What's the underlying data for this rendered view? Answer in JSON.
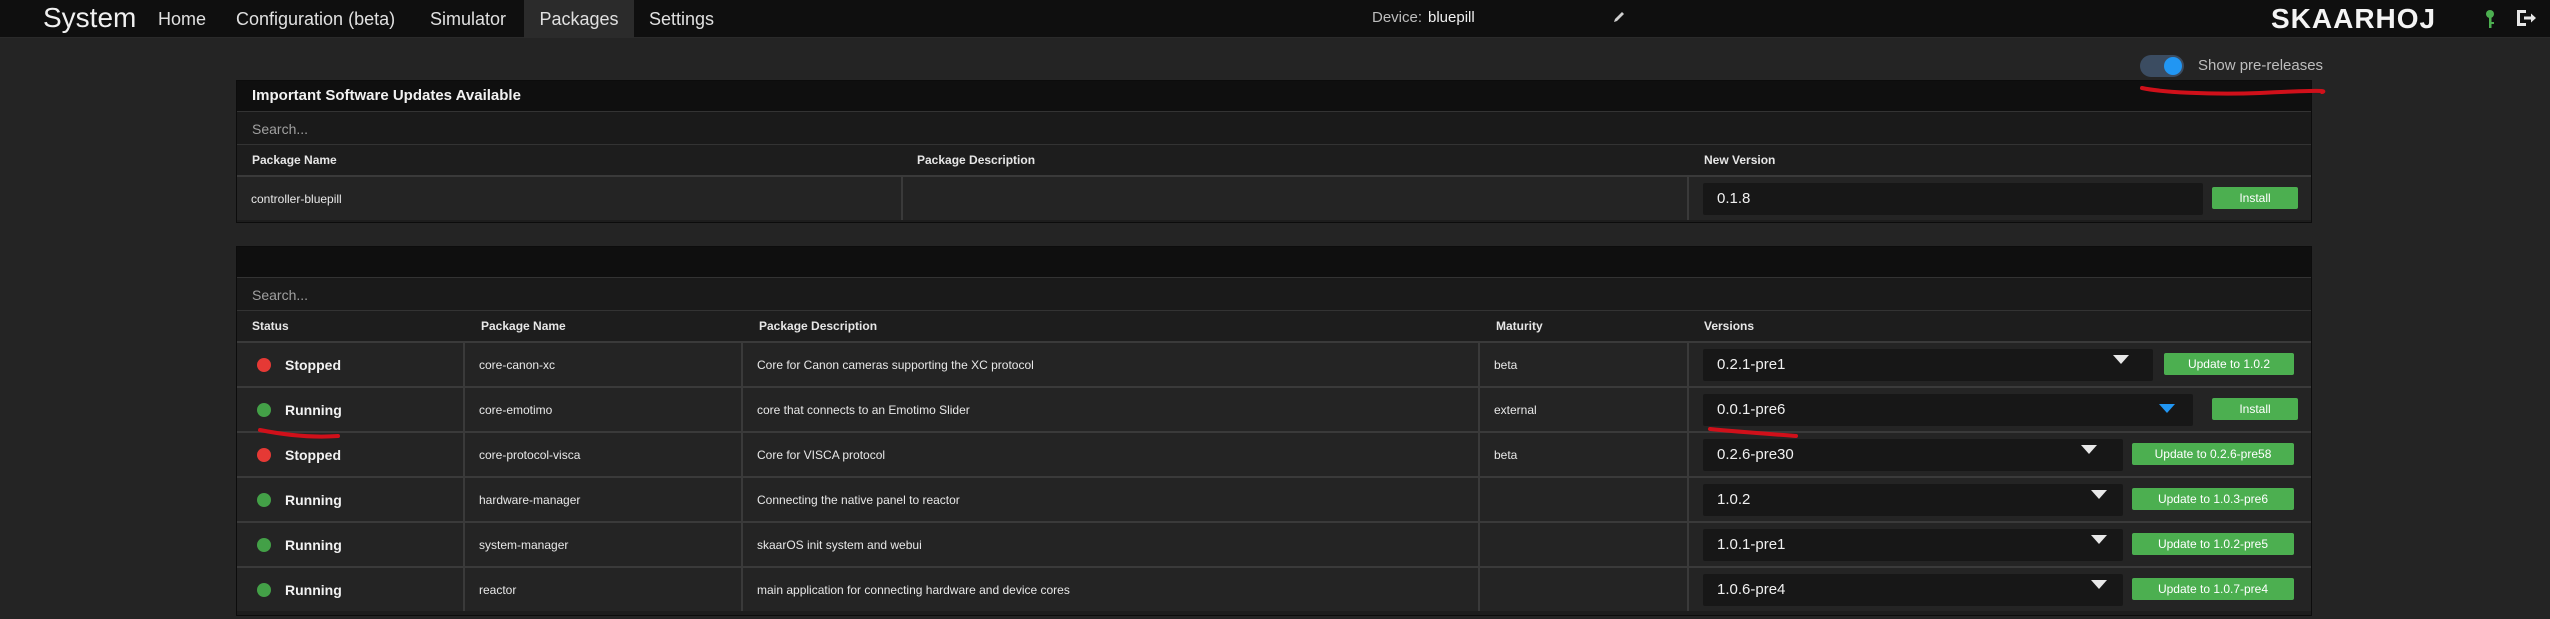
{
  "nav": {
    "brand": "System",
    "items": [
      "Home",
      "Configuration (beta)",
      "Simulator",
      "Packages",
      "Settings"
    ],
    "active": "Packages",
    "device_label": "Device:",
    "device_value": "bluepill",
    "logo": "SKAARHOJ"
  },
  "prerelease": {
    "label": "Show pre-releases",
    "enabled": true
  },
  "updates": {
    "title": "Important Software Updates Available",
    "search_placeholder": "Search...",
    "headers": [
      "Package Name",
      "Package Description",
      "New Version"
    ],
    "rows": [
      {
        "name": "controller-bluepill",
        "description": "",
        "version": "0.1.8",
        "action": "Install"
      }
    ]
  },
  "packages": {
    "title": "",
    "search_placeholder": "Search...",
    "headers": [
      "Status",
      "Package Name",
      "Package Description",
      "Maturity",
      "Versions"
    ],
    "rows": [
      {
        "status": "Stopped",
        "name": "core-canon-xc",
        "description": "Core for Canon cameras supporting the XC protocol",
        "maturity": "beta",
        "version": "0.2.1-pre1",
        "action": "Update to 1.0.2"
      },
      {
        "status": "Running",
        "name": "core-emotimo",
        "description": "core that connects to an Emotimo Slider",
        "maturity": "external",
        "version": "0.0.1-pre6",
        "action": "Install"
      },
      {
        "status": "Stopped",
        "name": "core-protocol-visca",
        "description": "Core for VISCA protocol",
        "maturity": "beta",
        "version": "0.2.6-pre30",
        "action": "Update to 0.2.6-pre58"
      },
      {
        "status": "Running",
        "name": "hardware-manager",
        "description": "Connecting the native panel to reactor",
        "maturity": "",
        "version": "1.0.2",
        "action": "Update to 1.0.3-pre6"
      },
      {
        "status": "Running",
        "name": "system-manager",
        "description": "skaarOS init system and webui",
        "maturity": "",
        "version": "1.0.1-pre1",
        "action": "Update to 1.0.2-pre5"
      },
      {
        "status": "Running",
        "name": "reactor",
        "description": "main application for connecting hardware and device cores",
        "maturity": "",
        "version": "1.0.6-pre4",
        "action": "Update to 1.0.7-pre4"
      }
    ]
  },
  "colors": {
    "running": "#43a047",
    "stopped": "#e53935",
    "accent": "#2196f3",
    "button": "#4caf50",
    "annotation": "#d0101a"
  }
}
